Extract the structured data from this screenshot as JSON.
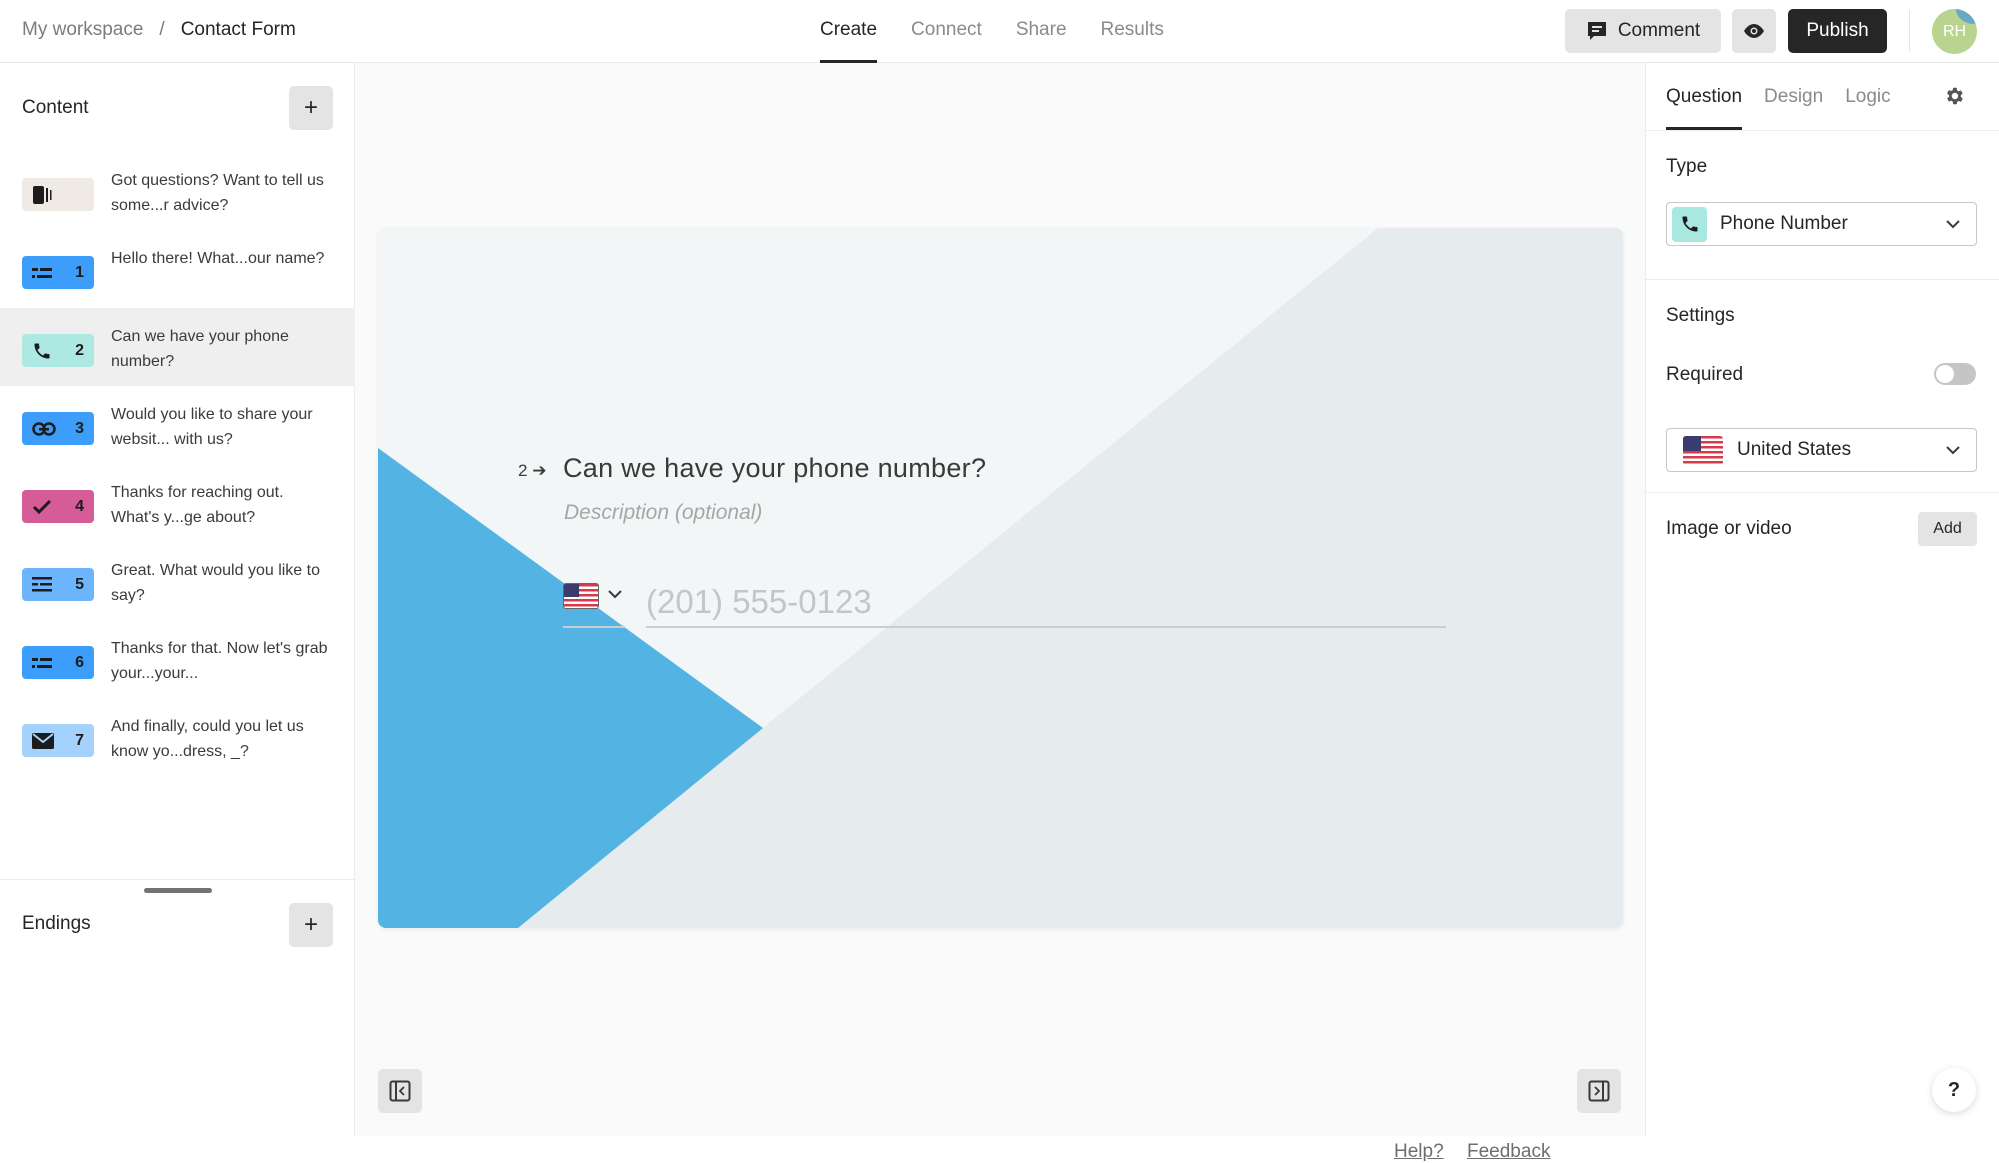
{
  "header": {
    "breadcrumb": {
      "workspace": "My workspace",
      "separator": "/",
      "form": "Contact Form"
    },
    "tabs": [
      {
        "label": "Create",
        "active": true
      },
      {
        "label": "Connect",
        "active": false
      },
      {
        "label": "Share",
        "active": false
      },
      {
        "label": "Results",
        "active": false
      }
    ],
    "comment_label": "Comment",
    "preview_icon": "eye-icon",
    "publish_label": "Publish",
    "avatar_initials": "RH"
  },
  "sidebar": {
    "content_title": "Content",
    "add_icon": "plus-icon",
    "items": [
      {
        "icon": "welcome-screen-icon",
        "number": "",
        "text": "Got questions? Want to tell us some...r advice?",
        "color": "#efebe4",
        "selected": false
      },
      {
        "icon": "short-text-icon",
        "number": "1",
        "text": "Hello there! What...our name?",
        "color": "#3c9dfb",
        "selected": false
      },
      {
        "icon": "phone-icon",
        "number": "2",
        "text": "Can we have your phone number?",
        "color": "#ade9e2",
        "selected": true
      },
      {
        "icon": "link-icon",
        "number": "3",
        "text": "Would you like to share your websit... with us?",
        "color": "#3c9dfb",
        "selected": false
      },
      {
        "icon": "checkmark-icon",
        "number": "4",
        "text": "Thanks for reaching out. What's y...ge about?",
        "color": "#d65c98",
        "selected": false
      },
      {
        "icon": "long-text-icon",
        "number": "5",
        "text": "Great. What would you like to say?",
        "color": "#6cb5fd",
        "selected": false
      },
      {
        "icon": "short-text-icon",
        "number": "6",
        "text": "Thanks for that. Now let's grab your...your...",
        "color": "#3c9dfb",
        "selected": false
      },
      {
        "icon": "envelope-icon",
        "number": "7",
        "text": "And finally, could you let us know yo...dress, _?",
        "color": "#a5d2fd",
        "selected": false
      }
    ],
    "endings_title": "Endings"
  },
  "canvas": {
    "question_number": "2",
    "question_title": "Can we have your phone number?",
    "description_placeholder": "Description (optional)",
    "phone_placeholder": "(201) 555-0123",
    "accent_color": "#53b4e3",
    "help_link": "Help?",
    "feedback_link": "Feedback"
  },
  "panel": {
    "tabs": [
      {
        "label": "Question",
        "active": true
      },
      {
        "label": "Design",
        "active": false
      },
      {
        "label": "Logic",
        "active": false
      }
    ],
    "type_label": "Type",
    "type_value": "Phone Number",
    "settings_label": "Settings",
    "required_label": "Required",
    "required_on": false,
    "country_value": "United States",
    "media_label": "Image or video",
    "media_add": "Add",
    "help_fab": "?"
  }
}
